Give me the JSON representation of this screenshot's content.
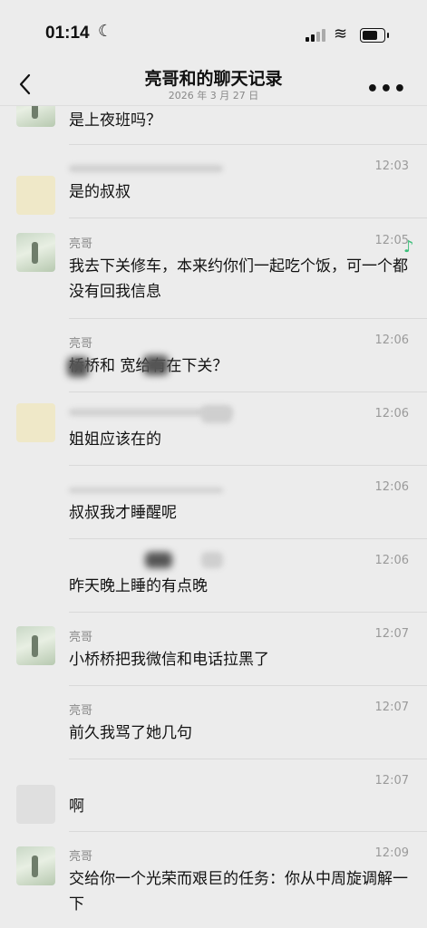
{
  "status_bar": {
    "time": "01:14",
    "moon": "☾",
    "wifi": "≋"
  },
  "header": {
    "title": "亮哥和的聊天记录",
    "date": "2026 年 3 月 27 日",
    "back_icon": "chevron-left-icon",
    "more_icon": "ellipsis-icon",
    "more_label": "•••"
  },
  "messages": [
    {
      "name": "",
      "time": "",
      "text": "是上夜班吗？"
    },
    {
      "name": "",
      "time": "12:03",
      "text": "是的叔叔"
    },
    {
      "name": "亮哥",
      "time": "12:05",
      "text": "我去下关修车，本来约你们一起吃个饭，可一个都没有回我信息"
    },
    {
      "name": "亮哥",
      "time": "12:06",
      "text": "桥桥和 宽给有在下关？"
    },
    {
      "name": "",
      "time": "12:06",
      "text": "姐姐应该在的"
    },
    {
      "name": "",
      "time": "12:06",
      "text": "叔叔我才睡醒呢"
    },
    {
      "name": "",
      "time": "12:06",
      "text": "昨天晚上睡的有点晚"
    },
    {
      "name": "亮哥",
      "time": "12:07",
      "text": "小桥桥把我微信和电话拉黑了"
    },
    {
      "name": "亮哥",
      "time": "12:07",
      "text": "前久我骂了她几句"
    },
    {
      "name": "",
      "time": "12:07",
      "text": "啊"
    },
    {
      "name": "亮哥",
      "time": "12:09",
      "text": "交给你一个光荣而艰巨的任务：你从中周旋调解一下"
    }
  ],
  "music_icon": "♪"
}
